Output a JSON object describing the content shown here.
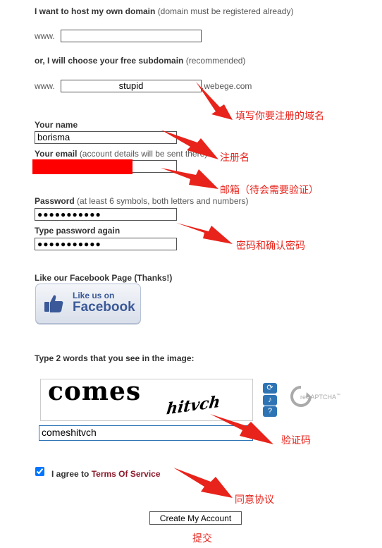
{
  "domain_section": {
    "own_domain_label": "I want to host my own domain",
    "own_domain_note": "(domain must be registered already)",
    "www_prefix": "www.",
    "own_domain_value": "",
    "free_sub_label": "or, I will choose your free subdomain",
    "free_sub_note": "(recommended)",
    "subdomain_value": "stupid",
    "subdomain_suffix": ".webege.com"
  },
  "account": {
    "name_label": "Your name",
    "name_value": "borisma",
    "email_label": "Your email",
    "email_note": "(account details will be sent there)",
    "password_label": "Password",
    "password_note": "(at least 6 symbols, both letters and numbers)",
    "password_value": "●●●●●●●●●●●",
    "password_again_label": "Type password again",
    "password_again_value": "●●●●●●●●●●●"
  },
  "facebook": {
    "label": "Like our Facebook Page (Thanks!)",
    "button_small": "Like us on",
    "button_big": "Facebook"
  },
  "captcha": {
    "label": "Type 2 words that you see in the image:",
    "word1": "comes",
    "word2": "hitvch",
    "input_value": "comeshitvch",
    "brand": "reCAPTCHA",
    "brand_tm": "™",
    "refresh_icon": "refresh-icon",
    "audio_icon": "audio-icon",
    "help_icon": "help-icon"
  },
  "terms": {
    "checked": true,
    "prefix": "I agree to",
    "link": "Terms Of Service"
  },
  "submit_label": "Create My Account",
  "annotations": {
    "domain": "填写你要注册的域名",
    "username": "注册名",
    "email": "邮箱（待会需要验证）",
    "password": "密码和确认密码",
    "captcha": "验证码",
    "agree": "同意协议",
    "submit": "提交"
  },
  "colors": {
    "annotation": "#e8231b",
    "facebook": "#3b5998",
    "link": "#8b1a2b"
  }
}
